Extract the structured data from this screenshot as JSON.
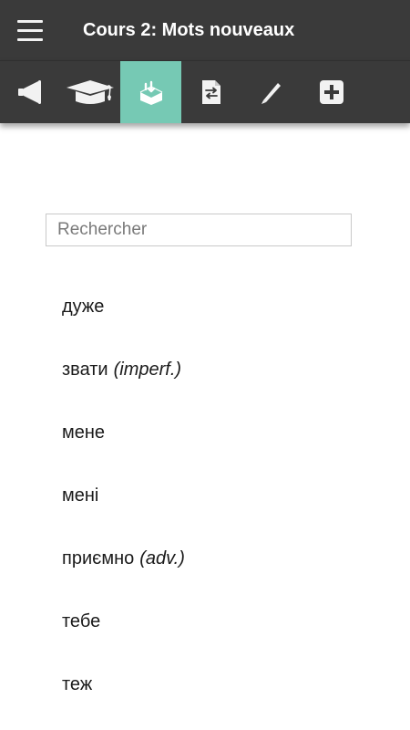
{
  "header": {
    "title": "Cours 2: Mots nouveaux",
    "menu_icon": "hamburger-menu-icon"
  },
  "toolbar": {
    "active_color": "#76c9b4",
    "background_color": "#3a3a3a",
    "tabs": [
      {
        "name": "tab-audio",
        "icon": "megaphone-icon"
      },
      {
        "name": "tab-lesson",
        "icon": "graduation-cap-icon"
      },
      {
        "name": "tab-vocabulary",
        "icon": "vocabulary-box-icon",
        "active": true
      },
      {
        "name": "tab-translation",
        "icon": "document-swap-icon"
      },
      {
        "name": "tab-writing",
        "icon": "pen-icon"
      },
      {
        "name": "tab-more",
        "icon": "plus-square-icon"
      }
    ]
  },
  "search": {
    "placeholder": "Rechercher",
    "value": ""
  },
  "words": [
    {
      "word": "дуже",
      "note": ""
    },
    {
      "word": "звати",
      "note": "(imperf.)"
    },
    {
      "word": "мене",
      "note": ""
    },
    {
      "word": "мені",
      "note": ""
    },
    {
      "word": "приємно",
      "note": "(adv.)"
    },
    {
      "word": "тебе",
      "note": ""
    },
    {
      "word": "теж",
      "note": ""
    }
  ]
}
